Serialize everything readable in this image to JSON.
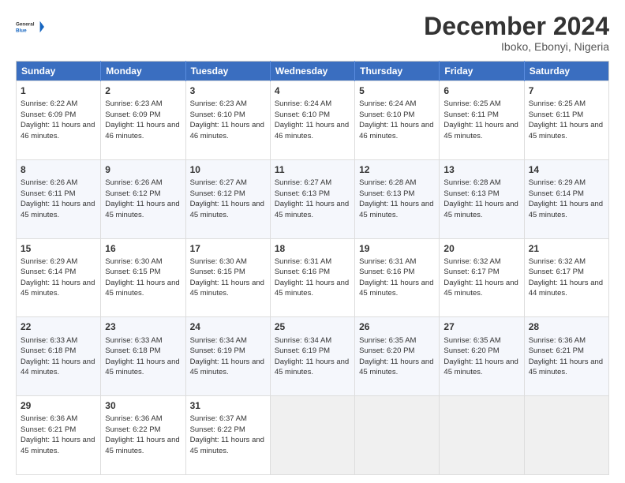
{
  "header": {
    "logo_line1": "General",
    "logo_line2": "Blue",
    "title": "December 2024",
    "subtitle": "Iboko, Ebonyi, Nigeria"
  },
  "calendar": {
    "days_of_week": [
      "Sunday",
      "Monday",
      "Tuesday",
      "Wednesday",
      "Thursday",
      "Friday",
      "Saturday"
    ],
    "weeks": [
      [
        {
          "day": "1",
          "sunrise": "6:22 AM",
          "sunset": "6:09 PM",
          "daylight": "11 hours and 46 minutes."
        },
        {
          "day": "2",
          "sunrise": "6:23 AM",
          "sunset": "6:09 PM",
          "daylight": "11 hours and 46 minutes."
        },
        {
          "day": "3",
          "sunrise": "6:23 AM",
          "sunset": "6:10 PM",
          "daylight": "11 hours and 46 minutes."
        },
        {
          "day": "4",
          "sunrise": "6:24 AM",
          "sunset": "6:10 PM",
          "daylight": "11 hours and 46 minutes."
        },
        {
          "day": "5",
          "sunrise": "6:24 AM",
          "sunset": "6:10 PM",
          "daylight": "11 hours and 46 minutes."
        },
        {
          "day": "6",
          "sunrise": "6:25 AM",
          "sunset": "6:11 PM",
          "daylight": "11 hours and 45 minutes."
        },
        {
          "day": "7",
          "sunrise": "6:25 AM",
          "sunset": "6:11 PM",
          "daylight": "11 hours and 45 minutes."
        }
      ],
      [
        {
          "day": "8",
          "sunrise": "6:26 AM",
          "sunset": "6:11 PM",
          "daylight": "11 hours and 45 minutes."
        },
        {
          "day": "9",
          "sunrise": "6:26 AM",
          "sunset": "6:12 PM",
          "daylight": "11 hours and 45 minutes."
        },
        {
          "day": "10",
          "sunrise": "6:27 AM",
          "sunset": "6:12 PM",
          "daylight": "11 hours and 45 minutes."
        },
        {
          "day": "11",
          "sunrise": "6:27 AM",
          "sunset": "6:13 PM",
          "daylight": "11 hours and 45 minutes."
        },
        {
          "day": "12",
          "sunrise": "6:28 AM",
          "sunset": "6:13 PM",
          "daylight": "11 hours and 45 minutes."
        },
        {
          "day": "13",
          "sunrise": "6:28 AM",
          "sunset": "6:13 PM",
          "daylight": "11 hours and 45 minutes."
        },
        {
          "day": "14",
          "sunrise": "6:29 AM",
          "sunset": "6:14 PM",
          "daylight": "11 hours and 45 minutes."
        }
      ],
      [
        {
          "day": "15",
          "sunrise": "6:29 AM",
          "sunset": "6:14 PM",
          "daylight": "11 hours and 45 minutes."
        },
        {
          "day": "16",
          "sunrise": "6:30 AM",
          "sunset": "6:15 PM",
          "daylight": "11 hours and 45 minutes."
        },
        {
          "day": "17",
          "sunrise": "6:30 AM",
          "sunset": "6:15 PM",
          "daylight": "11 hours and 45 minutes."
        },
        {
          "day": "18",
          "sunrise": "6:31 AM",
          "sunset": "6:16 PM",
          "daylight": "11 hours and 45 minutes."
        },
        {
          "day": "19",
          "sunrise": "6:31 AM",
          "sunset": "6:16 PM",
          "daylight": "11 hours and 45 minutes."
        },
        {
          "day": "20",
          "sunrise": "6:32 AM",
          "sunset": "6:17 PM",
          "daylight": "11 hours and 45 minutes."
        },
        {
          "day": "21",
          "sunrise": "6:32 AM",
          "sunset": "6:17 PM",
          "daylight": "11 hours and 44 minutes."
        }
      ],
      [
        {
          "day": "22",
          "sunrise": "6:33 AM",
          "sunset": "6:18 PM",
          "daylight": "11 hours and 44 minutes."
        },
        {
          "day": "23",
          "sunrise": "6:33 AM",
          "sunset": "6:18 PM",
          "daylight": "11 hours and 45 minutes."
        },
        {
          "day": "24",
          "sunrise": "6:34 AM",
          "sunset": "6:19 PM",
          "daylight": "11 hours and 45 minutes."
        },
        {
          "day": "25",
          "sunrise": "6:34 AM",
          "sunset": "6:19 PM",
          "daylight": "11 hours and 45 minutes."
        },
        {
          "day": "26",
          "sunrise": "6:35 AM",
          "sunset": "6:20 PM",
          "daylight": "11 hours and 45 minutes."
        },
        {
          "day": "27",
          "sunrise": "6:35 AM",
          "sunset": "6:20 PM",
          "daylight": "11 hours and 45 minutes."
        },
        {
          "day": "28",
          "sunrise": "6:36 AM",
          "sunset": "6:21 PM",
          "daylight": "11 hours and 45 minutes."
        }
      ],
      [
        {
          "day": "29",
          "sunrise": "6:36 AM",
          "sunset": "6:21 PM",
          "daylight": "11 hours and 45 minutes."
        },
        {
          "day": "30",
          "sunrise": "6:36 AM",
          "sunset": "6:22 PM",
          "daylight": "11 hours and 45 minutes."
        },
        {
          "day": "31",
          "sunrise": "6:37 AM",
          "sunset": "6:22 PM",
          "daylight": "11 hours and 45 minutes."
        },
        null,
        null,
        null,
        null
      ]
    ]
  }
}
